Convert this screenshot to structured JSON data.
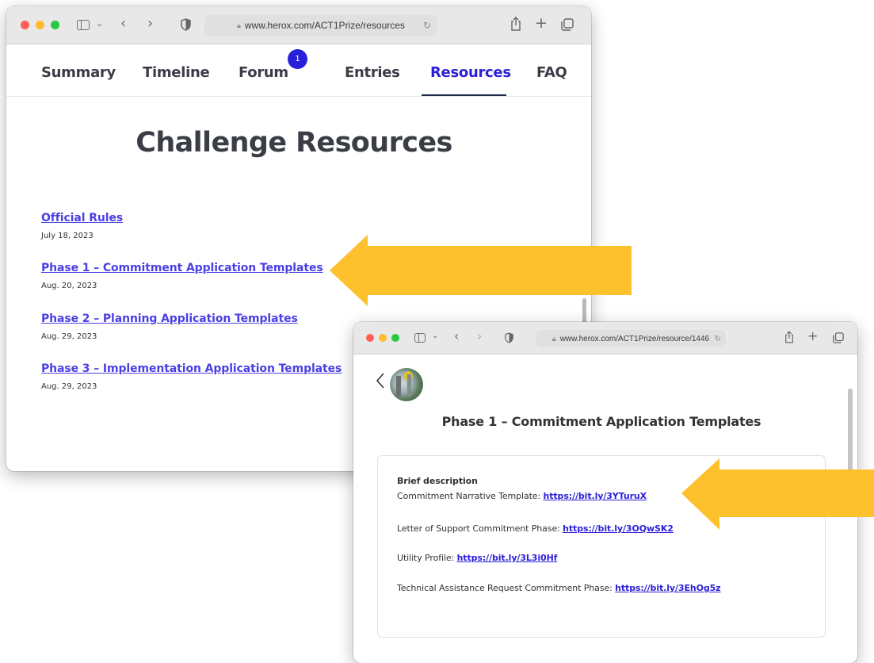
{
  "window1": {
    "url": "www.herox.com/ACT1Prize/resources",
    "nav": {
      "summary": "Summary",
      "timeline": "Timeline",
      "forum": "Forum",
      "forum_badge": "1",
      "entries": "Entries",
      "resources": "Resources",
      "faq": "FAQ"
    },
    "title": "Challenge Resources",
    "resources": [
      {
        "label": "Official Rules",
        "date": "July 18, 2023"
      },
      {
        "label": "Phase 1 – Commitment Application Templates",
        "date": "Aug. 20, 2023"
      },
      {
        "label": "Phase 2 – Planning Application Templates",
        "date": "Aug. 29, 2023"
      },
      {
        "label": "Phase 3 – Implementation Application Templates",
        "date": "Aug. 29, 2023"
      }
    ]
  },
  "window2": {
    "url": "www.herox.com/ACT1Prize/resource/1446",
    "title": "Phase 1 – Commitment Application Templates",
    "card": {
      "heading": "Brief description",
      "items": [
        {
          "label": "Commitment Narrative Template:",
          "link": "https://bit.ly/3YTuruX"
        },
        {
          "label": "Letter of Support Commitment Phase:",
          "link": "https://bit.ly/3OQwSK2"
        },
        {
          "label": "Utility Profile:",
          "link": "https://bit.ly/3L3i0Hf"
        },
        {
          "label": "Technical Assistance Request Commitment Phase:",
          "link": "https://bit.ly/3EhOg5z"
        }
      ]
    }
  },
  "colors": {
    "arrow": "#fdc12e",
    "link": "#4b3fe4",
    "active_tab": "#2d20d8",
    "badge": "#2820d8"
  },
  "icons": [
    "sidebar-icon",
    "chevron-down-icon",
    "back-icon",
    "forward-icon",
    "shield-icon",
    "lock-icon",
    "reload-icon",
    "share-icon",
    "plus-icon",
    "tabs-icon"
  ]
}
